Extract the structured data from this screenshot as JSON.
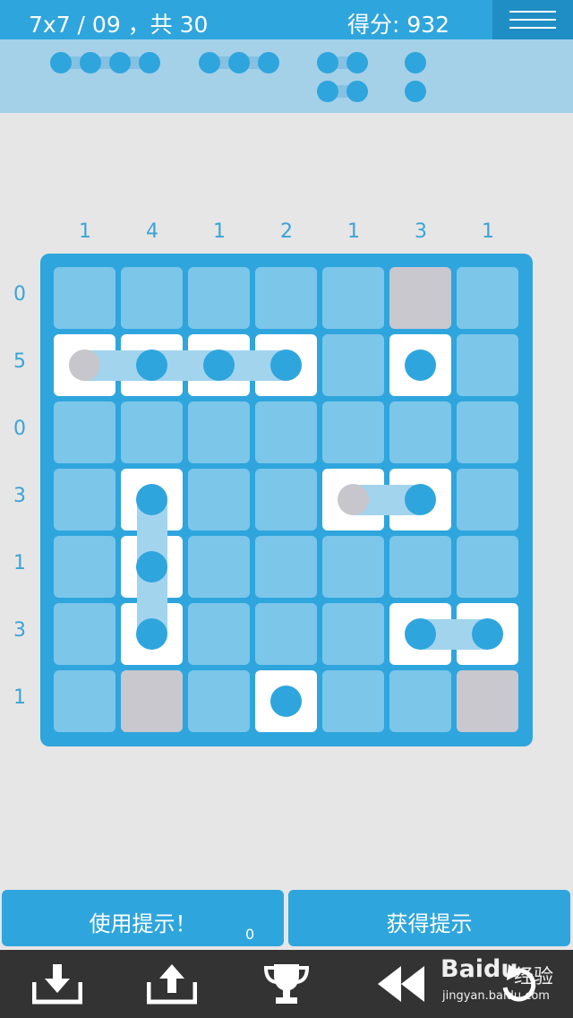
{
  "header": {
    "level": "7x7 / 09 ，共 30",
    "score": "得分: 932",
    "menu_icon": "hamburger-icon"
  },
  "fleet": [
    {
      "size": 4,
      "count": 1
    },
    {
      "size": 3,
      "count": 1
    },
    {
      "size": 2,
      "count": 2
    },
    {
      "size": 1,
      "count": 2
    }
  ],
  "puzzle": {
    "size": 7,
    "col_clues": [
      "1",
      "4",
      "1",
      "2",
      "1",
      "3",
      "1"
    ],
    "row_clues": [
      "0",
      "5",
      "0",
      "3",
      "1",
      "3",
      "1"
    ],
    "grid": [
      [
        "e",
        "e",
        "e",
        "e",
        "e",
        "w",
        "e"
      ],
      [
        "p",
        "s",
        "s",
        "s",
        "e",
        "s",
        "e"
      ],
      [
        "e",
        "e",
        "e",
        "e",
        "e",
        "e",
        "e"
      ],
      [
        "e",
        "s",
        "e",
        "e",
        "p",
        "s",
        "e"
      ],
      [
        "e",
        "s",
        "e",
        "e",
        "e",
        "e",
        "e"
      ],
      [
        "e",
        "s",
        "e",
        "e",
        "e",
        "s",
        "s"
      ],
      [
        "e",
        "w",
        "e",
        "s",
        "e",
        "e",
        "w"
      ]
    ],
    "links": [
      {
        "row": 1,
        "from_col": 0,
        "to_col": 3
      },
      {
        "row": 3,
        "from_col": 4,
        "to_col": 5
      },
      {
        "row": 5,
        "from_col": 5,
        "to_col": 6
      },
      {
        "col": 1,
        "from_row": 3,
        "to_row": 5
      }
    ],
    "colors": {
      "ocean": "#2fa5dd",
      "empty": "#7cc6e9",
      "water": "#c9c8ce",
      "ship": "#ffffff"
    }
  },
  "buttons": {
    "use_hint": "使用提示！",
    "hint_count": "0",
    "get_hint": "获得提示"
  },
  "toolbar": [
    {
      "name": "download-icon"
    },
    {
      "name": "upload-icon"
    },
    {
      "name": "trophy-icon"
    },
    {
      "name": "rewind-icon"
    },
    {
      "name": "undo-icon"
    }
  ],
  "watermark": {
    "brand": "Baidu",
    "brand_cn": "经验",
    "site": "jingyan.baidu.com"
  }
}
